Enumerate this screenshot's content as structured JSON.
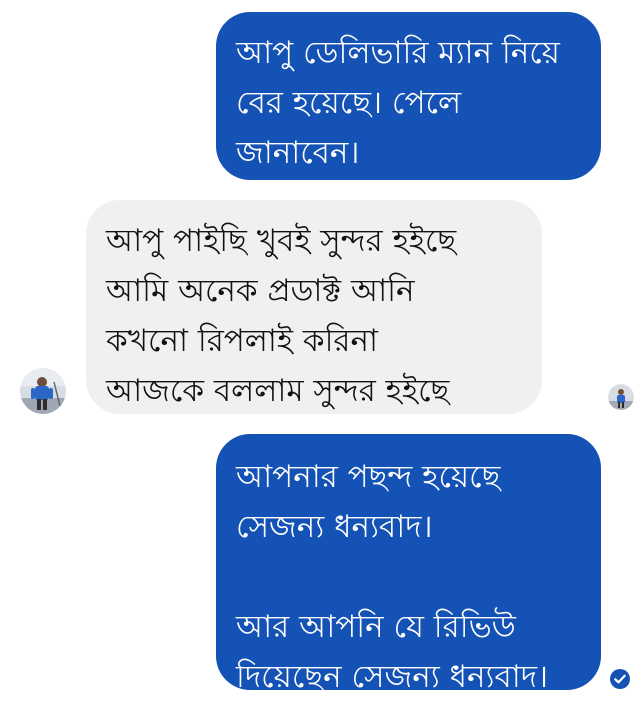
{
  "messages": [
    {
      "direction": "outgoing",
      "text": "আপু ডেলিভারি ম্যান নিয়ে\nবের হয়েছে। পেলে\nজানাবেন।"
    },
    {
      "direction": "incoming",
      "text": "আপু পাইছি খুবই সুন্দর হইছে\nআমি অনেক প্রডাক্ট আনি\nকখনো রিপলাই করিনা\nআজকে  বললাম  সুন্দর হইছে"
    },
    {
      "direction": "outgoing",
      "text": "আপনার পছন্দ হয়েছে\nসেজন্য ধন্যবাদ।\n\nআর আপনি যে রিভিউ\nদিয়েছেন সেজন্য ধন্যবাদ।"
    }
  ],
  "colors": {
    "outgoing_bubble": "#1452b5",
    "incoming_bubble": "#f0f0f0",
    "outgoing_text": "#ffffff",
    "incoming_text": "#111111"
  },
  "icons": {
    "contact_avatar": "contact-avatar",
    "seen_avatar": "seen-avatar",
    "delivered_status": "check-circle-icon"
  }
}
